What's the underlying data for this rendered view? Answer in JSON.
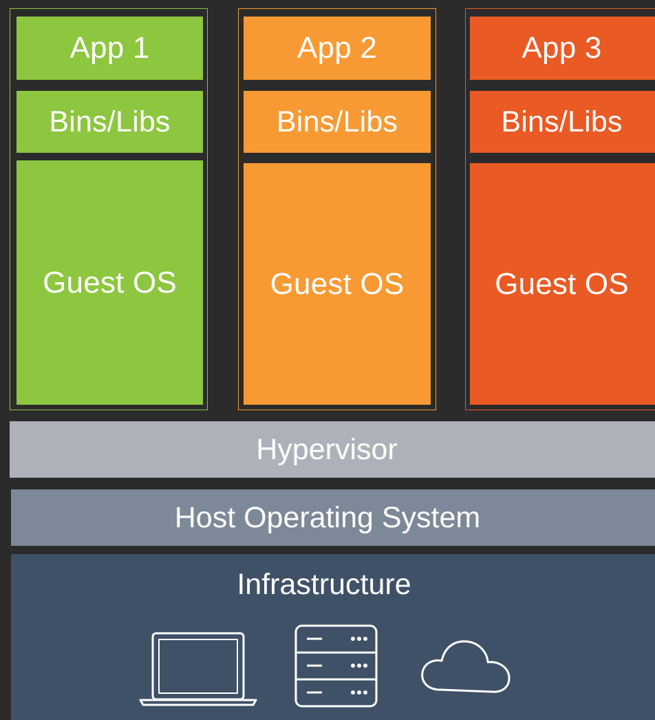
{
  "colors": {
    "background": "#2b2b2b",
    "app1": "#8dc63f",
    "app2": "#f89a33",
    "app3": "#e95a24",
    "hypervisor": "#adb2ba",
    "host_os": "#7d8898",
    "infrastructure": "#3f5167"
  },
  "vms": [
    {
      "app": "App 1",
      "bins": "Bins/Libs",
      "guest": "Guest OS"
    },
    {
      "app": "App 2",
      "bins": "Bins/Libs",
      "guest": "Guest OS"
    },
    {
      "app": "App 3",
      "bins": "Bins/Libs",
      "guest": "Guest OS"
    }
  ],
  "layers": {
    "hypervisor": "Hypervisor",
    "host_os": "Host Operating System",
    "infrastructure": "Infrastructure"
  },
  "icons": [
    "laptop-icon",
    "server-icon",
    "cloud-icon"
  ]
}
